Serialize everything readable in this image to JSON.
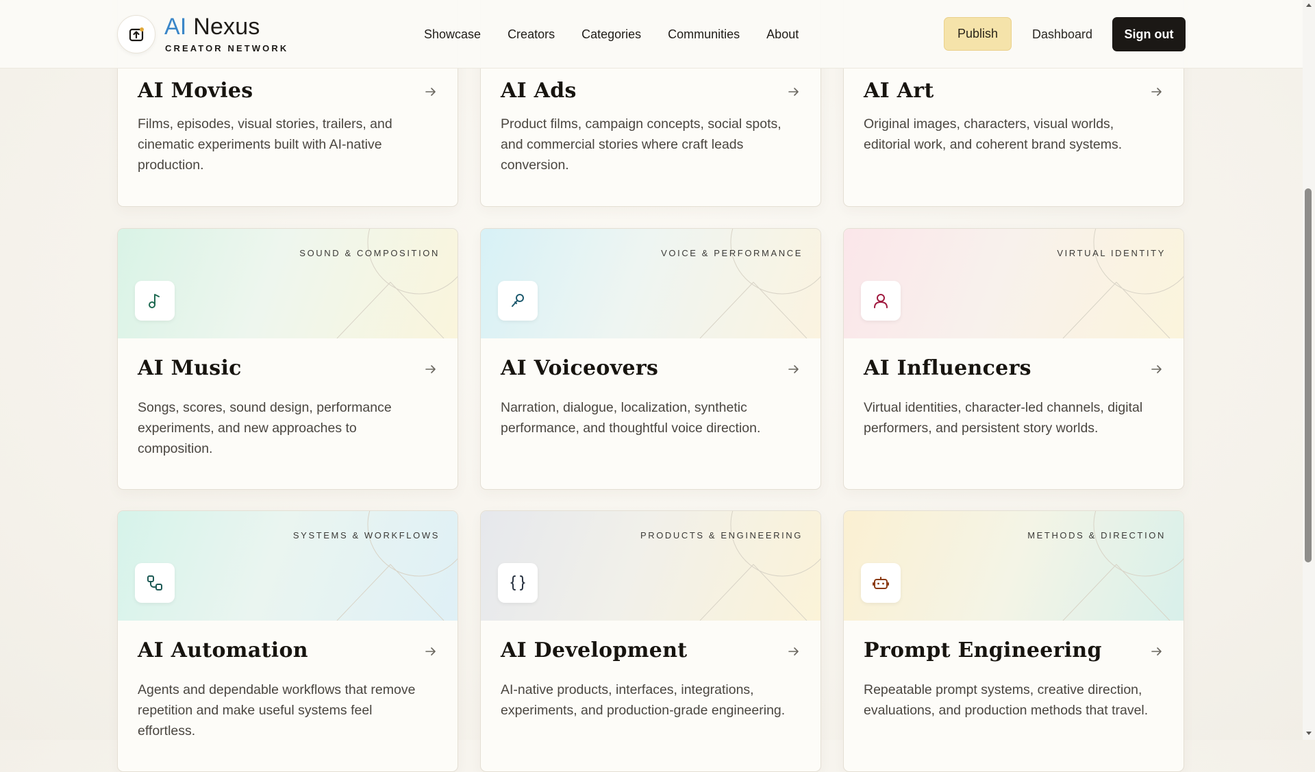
{
  "brand": {
    "ai": "AI",
    "name": "Nexus",
    "subtitle": "CREATOR NETWORK"
  },
  "nav": [
    "Showcase",
    "Creators",
    "Categories",
    "Communities",
    "About"
  ],
  "actions": {
    "publish": "Publish",
    "dashboard": "Dashboard",
    "signout": "Sign out"
  },
  "cards": [
    {
      "title": "AI Movies",
      "desc": "Films, episodes, visual stories, trailers, and cinematic experiments built with AI-native production."
    },
    {
      "title": "AI Ads",
      "desc": "Product films, campaign concepts, social spots, and commercial stories where craft leads conversion."
    },
    {
      "title": "AI Art",
      "desc": "Original images, characters, visual worlds, editorial work, and coherent brand systems."
    },
    {
      "tag": "SOUND & COMPOSITION",
      "icon": "music-note-icon",
      "title": "AI Music",
      "desc": "Songs, scores, sound design, performance experiments, and new approaches to composition."
    },
    {
      "tag": "VOICE & PERFORMANCE",
      "icon": "microphone-icon",
      "title": "AI Voiceovers",
      "desc": "Narration, dialogue, localization, synthetic performance, and thoughtful voice direction."
    },
    {
      "tag": "VIRTUAL IDENTITY",
      "icon": "user-icon",
      "title": "AI Influencers",
      "desc": "Virtual identities, character-led channels, digital performers, and persistent story worlds."
    },
    {
      "tag": "SYSTEMS & WORKFLOWS",
      "icon": "workflow-icon",
      "title": "AI Automation",
      "desc": "Agents and dependable workflows that remove repetition and make useful systems feel effortless."
    },
    {
      "tag": "PRODUCTS & ENGINEERING",
      "icon": "code-braces-icon",
      "title": "AI Development",
      "desc": "AI-native products, interfaces, integrations, experiments, and production-grade engineering."
    },
    {
      "tag": "METHODS & DIRECTION",
      "icon": "robot-icon",
      "title": "Prompt Engineering",
      "desc": "Repeatable prompt systems, creative direction, evaluations, and production methods that travel."
    }
  ],
  "colors": {
    "accent": "#3a86c8",
    "publish_bg": "#f5e3aa",
    "signout_bg": "#1b1815"
  }
}
